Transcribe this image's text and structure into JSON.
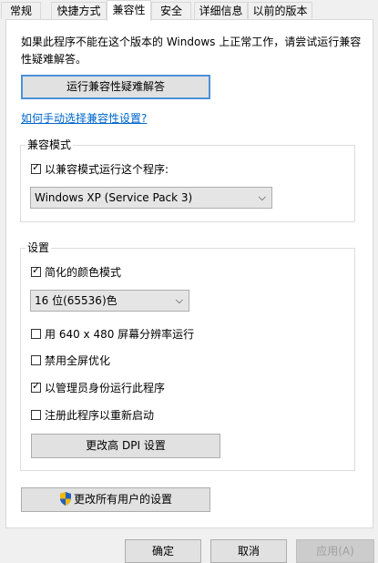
{
  "tabs": [
    {
      "label": "常规"
    },
    {
      "label": "快捷方式"
    },
    {
      "label": "兼容性"
    },
    {
      "label": "安全"
    },
    {
      "label": "详细信息"
    },
    {
      "label": "以前的版本"
    }
  ],
  "intro_text": "如果此程序不能在这个版本的 Windows 上正常工作，请尝试运行兼容性疑难解答。",
  "troubleshooter_button": "运行兼容性疑难解答",
  "manual_link": "如何手动选择兼容性设置?",
  "compat_mode": {
    "title": "兼容模式",
    "checkbox_label": "以兼容模式运行这个程序:",
    "checked": true,
    "selected_os": "Windows XP (Service Pack 3)"
  },
  "settings": {
    "title": "设置",
    "reduced_color": {
      "label": "简化的颜色模式",
      "checked": true
    },
    "color_select": "16 位(65536)色",
    "run_640": {
      "label": "用 640 x 480 屏幕分辨率运行",
      "checked": false
    },
    "disable_fullscreen": {
      "label": "禁用全屏优化",
      "checked": false
    },
    "run_admin": {
      "label": "以管理员身份运行此程序",
      "checked": true
    },
    "register_restart": {
      "label": "注册此程序以重新启动",
      "checked": false
    },
    "dpi_button": "更改高 DPI 设置"
  },
  "all_users_button": "更改所有用户的设置",
  "footer": {
    "ok": "确定",
    "cancel": "取消",
    "apply": "应用(A)"
  },
  "icons": {
    "shield": "uac-shield-icon",
    "dropdown": "chevron-down-icon",
    "check": "checkmark-icon"
  }
}
